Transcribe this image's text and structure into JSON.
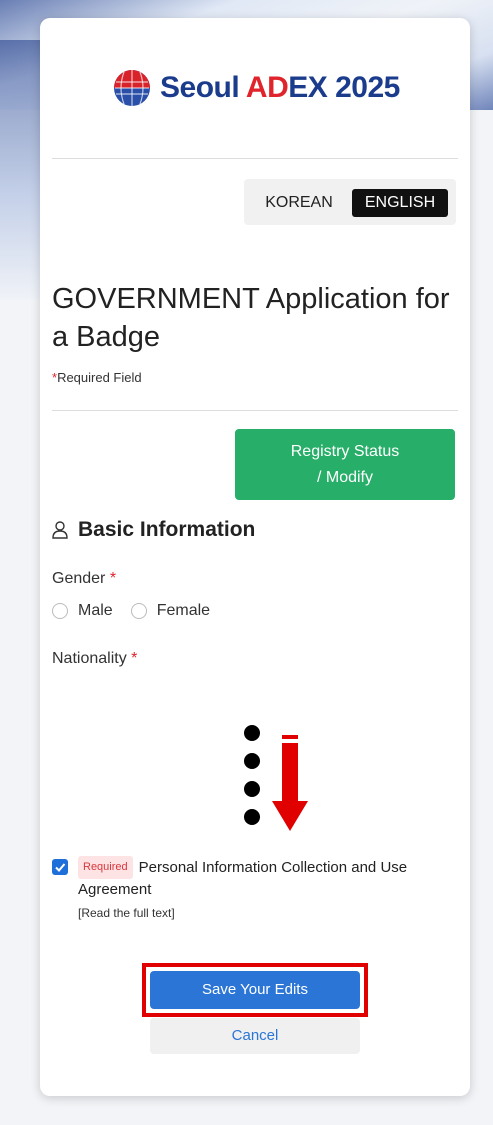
{
  "logo": {
    "text_prefix": "Seoul ",
    "text_accent": "AD",
    "text_suffix": "EX 2025",
    "accent_color": "#e0242b",
    "brand_color": "#1b3c8c"
  },
  "language": {
    "korean": "KOREAN",
    "english": "ENGLISH",
    "selected": "ENGLISH"
  },
  "form": {
    "title": "GOVERNMENT Application for a Badge",
    "required_star": "*",
    "required_note": "Required Field",
    "registry_line1": "Registry Status",
    "registry_line2": "/ Modify",
    "section_title": "Basic Information",
    "gender_label": "Gender",
    "gender_options": [
      "Male",
      "Female"
    ],
    "nationality_label": "Nationality"
  },
  "agreement": {
    "badge": "Required",
    "text": "Personal Information Collection and Use Agreement",
    "read_full": "[Read the full text]",
    "checked": true
  },
  "actions": {
    "save": "Save Your Edits",
    "cancel": "Cancel"
  },
  "colors": {
    "save": "#2a75d6",
    "registry": "#27ae68",
    "highlight": "#e00000"
  }
}
